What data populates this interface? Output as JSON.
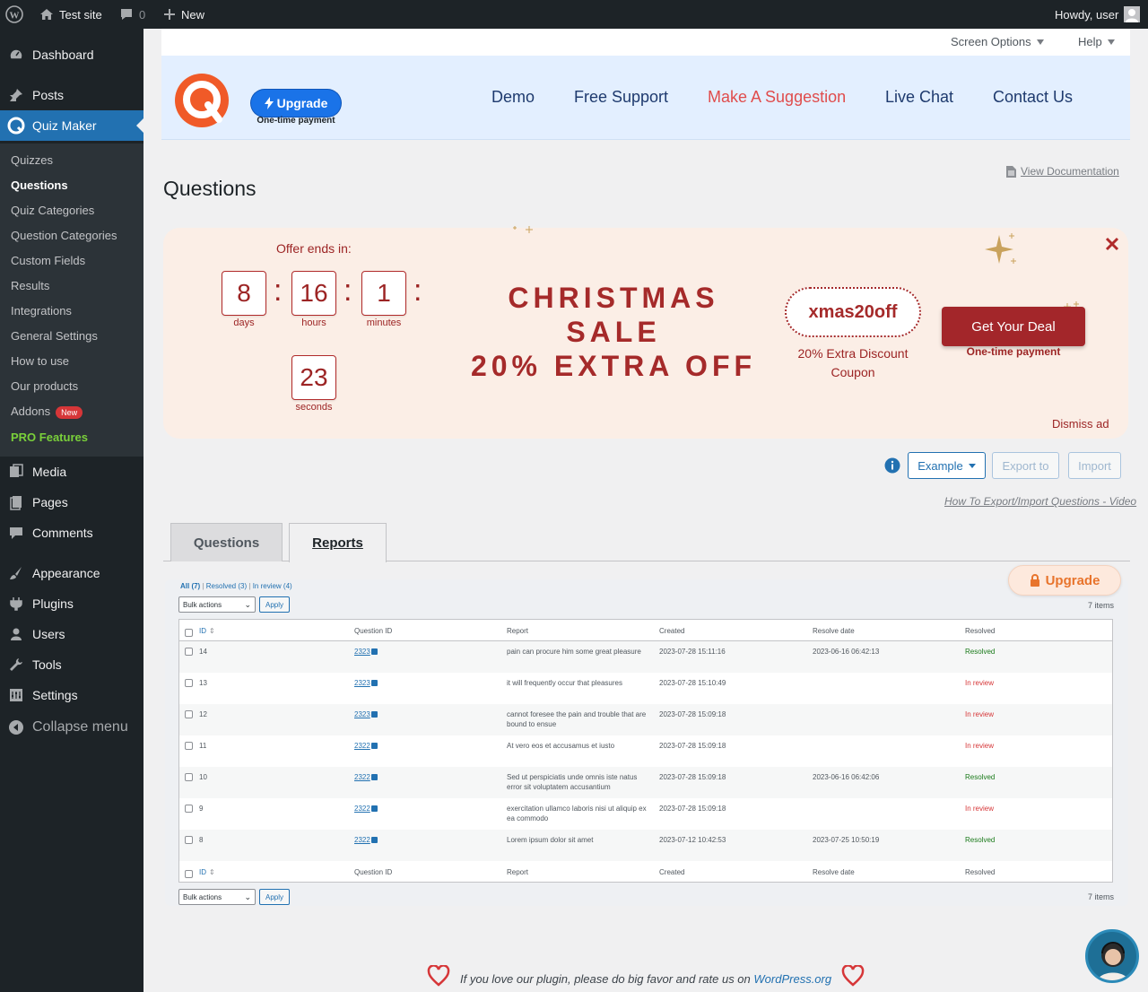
{
  "adminbar": {
    "site_name": "Test site",
    "comments_count": "0",
    "new_label": "New",
    "howdy": "Howdy, user"
  },
  "sidebar": {
    "dashboard": "Dashboard",
    "posts": "Posts",
    "quiz_maker": "Quiz Maker",
    "submenu": [
      "Quizzes",
      "Questions",
      "Quiz Categories",
      "Question Categories",
      "Custom Fields",
      "Results",
      "Integrations",
      "General Settings",
      "How to use",
      "Our products",
      "Addons"
    ],
    "addons_badge": "New",
    "pro_features": "PRO Features",
    "media": "Media",
    "pages": "Pages",
    "comments": "Comments",
    "appearance": "Appearance",
    "plugins": "Plugins",
    "users": "Users",
    "tools": "Tools",
    "settings": "Settings",
    "collapse": "Collapse menu"
  },
  "topbar": {
    "screen_options": "Screen Options",
    "help": "Help"
  },
  "banner": {
    "upgrade": "Upgrade",
    "one_time": "One-time payment",
    "links": [
      "Demo",
      "Free Support",
      "Make A Suggestion",
      "Live Chat",
      "Contact Us"
    ]
  },
  "page": {
    "title": "Questions",
    "view_docs": "View Documentation"
  },
  "promo": {
    "offer_ends": "Offer ends in:",
    "days": "8",
    "days_label": "days",
    "hours": "16",
    "hours_label": "hours",
    "minutes": "1",
    "minutes_label": "minutes",
    "seconds": "23",
    "seconds_label": "seconds",
    "sale_line1": "CHRISTMAS",
    "sale_line2": "SALE",
    "sale_line3": "20% EXTRA OFF",
    "coupon_code": "xmas20off",
    "coupon_desc1": "20% Extra Discount",
    "coupon_desc2": "Coupon",
    "deal_button": "Get Your Deal",
    "deal_sub": "One-time payment",
    "dismiss": "Dismiss ad",
    "colors": {
      "accent": "#a52a2a",
      "deal_bg": "#a3262a",
      "bg": "#fbeee6"
    }
  },
  "actions": {
    "example": "Example",
    "export": "Export to",
    "import": "Import",
    "video_link": "How To Export/Import Questions - Video"
  },
  "tabs": {
    "questions": "Questions",
    "reports": "Reports"
  },
  "report": {
    "upgrade": "Upgrade",
    "filters": {
      "all": "All (7)",
      "resolved": "Resolved (3)",
      "in_review": "In review (4)"
    },
    "bulk_actions": "Bulk actions",
    "apply": "Apply",
    "items_count": "7 items",
    "headers": [
      "ID",
      "Question ID",
      "Report",
      "Created",
      "Resolve date",
      "Resolved"
    ],
    "rows": [
      {
        "id": "14",
        "qid": "2323",
        "report": "pain can procure him some great pleasure",
        "created": "2023-07-28 15:11:16",
        "resolve_date": "2023-06-16 06:42:13",
        "status": "Resolved"
      },
      {
        "id": "13",
        "qid": "2323",
        "report": "it will frequently occur that pleasures",
        "created": "2023-07-28 15:10:49",
        "resolve_date": "",
        "status": "In review"
      },
      {
        "id": "12",
        "qid": "2323",
        "report": "cannot foresee the pain and trouble that are bound to ensue",
        "created": "2023-07-28 15:09:18",
        "resolve_date": "",
        "status": "In review"
      },
      {
        "id": "11",
        "qid": "2322",
        "report": "At vero eos et accusamus et iusto",
        "created": "2023-07-28 15:09:18",
        "resolve_date": "",
        "status": "In review"
      },
      {
        "id": "10",
        "qid": "2322",
        "report": "Sed ut perspiciatis unde omnis iste natus error sit voluptatem accusantium",
        "created": "2023-07-28 15:09:18",
        "resolve_date": "2023-06-16 06:42:06",
        "status": "Resolved"
      },
      {
        "id": "9",
        "qid": "2322",
        "report": "exercitation ullamco laboris nisi ut aliquip ex ea commodo",
        "created": "2023-07-28 15:09:18",
        "resolve_date": "",
        "status": "In review"
      },
      {
        "id": "8",
        "qid": "2322",
        "report": "Lorem ipsum dolor sit amet",
        "created": "2023-07-12 10:42:53",
        "resolve_date": "2023-07-25 10:50:19",
        "status": "Resolved"
      }
    ],
    "colors": {
      "resolved": "#1a7a1a",
      "in_review": "#d63638"
    }
  },
  "footer": {
    "text": "If you love our plugin, please do big favor and rate us on",
    "link": "WordPress.org"
  }
}
